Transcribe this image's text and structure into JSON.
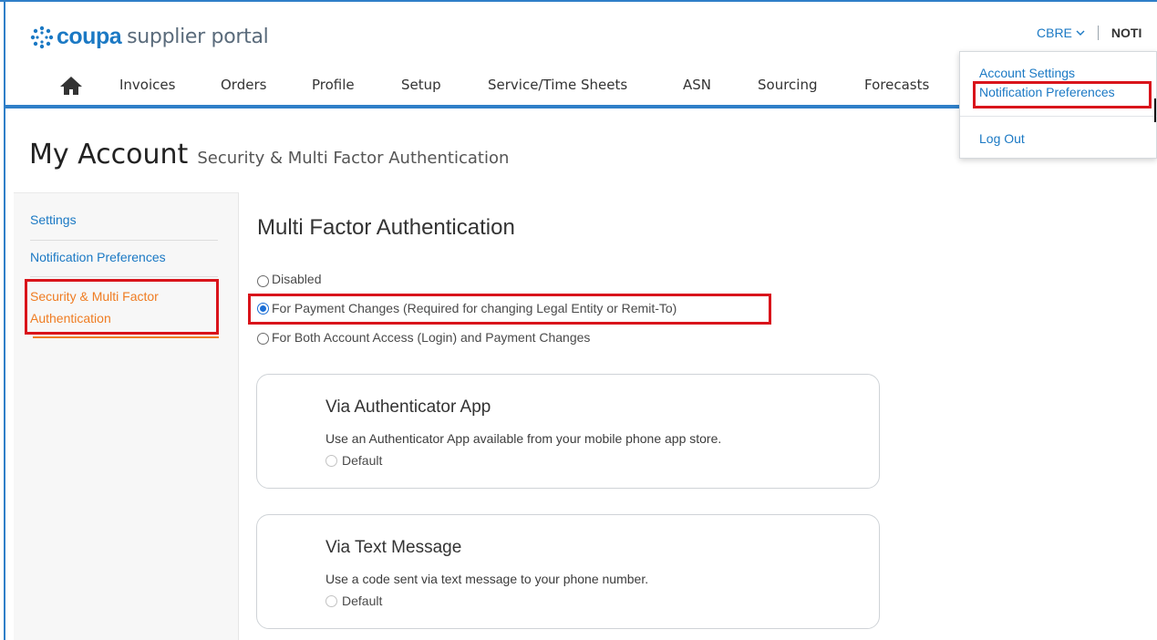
{
  "header": {
    "logo_word": "coupa",
    "logo_sub": "supplier portal",
    "account_name": "CBRE",
    "notifications_label": "NOTI"
  },
  "nav": {
    "items": [
      "Invoices",
      "Orders",
      "Profile",
      "Setup",
      "Service/Time Sheets",
      "ASN",
      "Sourcing",
      "Forecasts"
    ]
  },
  "account_menu": {
    "account_settings": "Account Settings",
    "notification_preferences": "Notification Preferences",
    "log_out": "Log Out"
  },
  "page": {
    "title": "My Account",
    "subtitle": "Security & Multi Factor Authentication"
  },
  "sidebar": {
    "items": [
      {
        "label": "Settings"
      },
      {
        "label": "Notification Preferences"
      },
      {
        "label_line1": "Security & Multi Factor",
        "label_line2": "Authentication",
        "active": true
      }
    ]
  },
  "mfa": {
    "title": "Multi Factor Authentication",
    "options": [
      {
        "label": "Disabled",
        "checked": false
      },
      {
        "label": "For Payment Changes (Required for changing Legal Entity or Remit-To)",
        "checked": true
      },
      {
        "label": "For Both Account Access (Login) and Payment Changes",
        "checked": false
      }
    ],
    "methods": [
      {
        "title": "Via Authenticator App",
        "description": "Use an Authenticator App available from your mobile phone app store.",
        "default_label": "Default"
      },
      {
        "title": "Via Text Message",
        "description": "Use a code sent via text message to your phone number.",
        "default_label": "Default"
      }
    ]
  },
  "colors": {
    "brand_blue": "#1b79c4",
    "active_orange": "#ef7c22",
    "highlight_red": "#d9141b"
  }
}
